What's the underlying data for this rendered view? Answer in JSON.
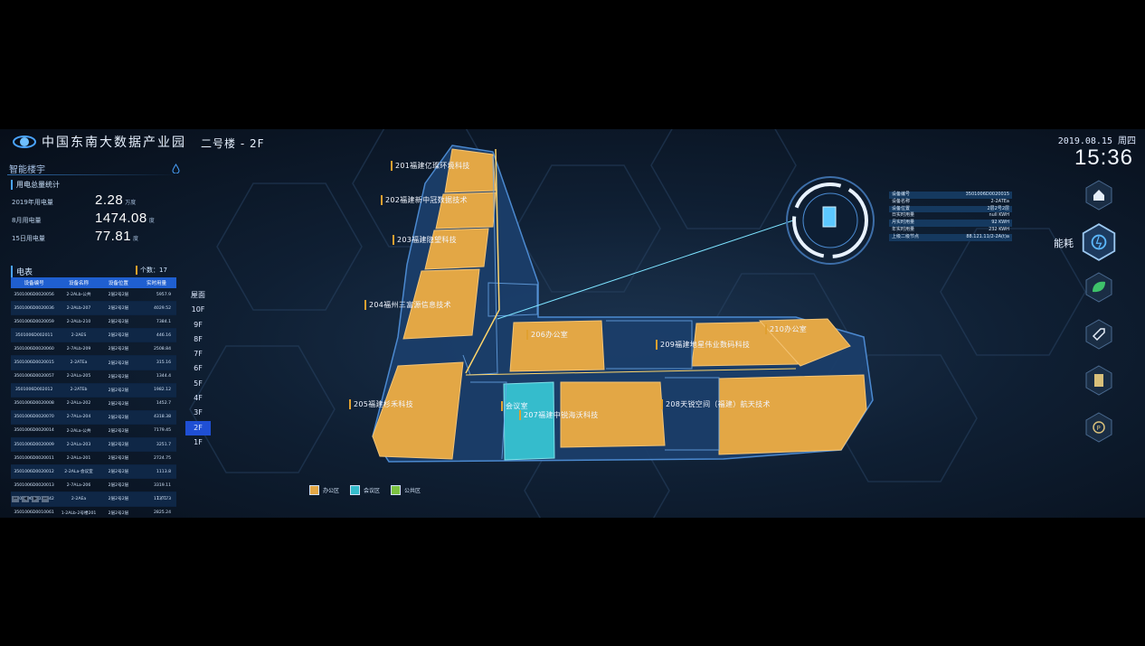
{
  "app_title": "中国东南大数据产业园",
  "building": "二号楼 - 2F",
  "datetime": {
    "date": "2019.08.15 周四",
    "time": "15:36"
  },
  "panel": {
    "title": "智能楼宇"
  },
  "stats": {
    "section_title": "用电总量统计",
    "rows": [
      {
        "label": "2019年用电量",
        "value": "2.28",
        "unit": "万度"
      },
      {
        "label": "8月用电量",
        "value": "1474.08",
        "unit": "度"
      },
      {
        "label": "15日用电量",
        "value": "77.81",
        "unit": "度"
      }
    ]
  },
  "meter": {
    "title": "电表",
    "count": "个数：17",
    "headers": [
      "设备编号",
      "设备名称",
      "设备位置",
      "实时用量"
    ],
    "rows": [
      [
        "3501006D0020056",
        "2-2ALb-公共",
        "2层2号2层",
        "5957.9"
      ],
      [
        "3501006D0020036",
        "2-2ALb-207",
        "2层2号2层",
        "4029.52"
      ],
      [
        "3501006D0020059",
        "2-2ALb-210",
        "2层2号2层",
        "7384.1"
      ],
      [
        "3501006D002011",
        "2-2AES",
        "2层2号2层",
        "446.16"
      ],
      [
        "3501006D0020060",
        "2-7ALb-209",
        "2层2号2层",
        "2508.84"
      ],
      [
        "3501006D0020015",
        "2-2ATEa",
        "2层2号2层",
        "315.16"
      ],
      [
        "3501006D0020057",
        "2-2ALa-205",
        "2层2号2层",
        "1344.4"
      ],
      [
        "3501006D002012",
        "2-2ATEb",
        "2层2号2层",
        "1982.12"
      ],
      [
        "3501006D0020008",
        "2-2ALa-202",
        "2层2号2层",
        "1452.7"
      ],
      [
        "3501006D0020070",
        "2-7ALa-204",
        "2层2号2层",
        "4318.38"
      ],
      [
        "3501006D0020014",
        "2-2ALa-公共",
        "2层2号2层",
        "7179.45"
      ],
      [
        "3501006D0020009",
        "2-2ALa-203",
        "2层2号2层",
        "3251.7"
      ],
      [
        "3501006D0020011",
        "2-2ALa-201",
        "2层2号2层",
        "2724.75"
      ],
      [
        "3501006D0020012",
        "2-2ALa-会议室",
        "2层2号2层",
        "1113.8"
      ],
      [
        "3501006D0020013",
        "2-7ALa-206",
        "2层2号2层",
        "3319.11"
      ],
      [
        "3501006D0020142",
        "2-2AEa",
        "2层2号2层",
        "1737.73"
      ],
      [
        "3501006D0010061",
        "1-2ALb-2号楼201",
        "2层2号2层",
        "2825.24"
      ]
    ],
    "page": "1 / 1"
  },
  "floors": {
    "items": [
      "屋面",
      "10F",
      "9F",
      "8F",
      "7F",
      "6F",
      "5F",
      "4F",
      "3F",
      "2F",
      "1F"
    ],
    "active": "2F"
  },
  "rooms": [
    {
      "name": "201福建亿璨环境科技"
    },
    {
      "name": "202福建新中冠数据技术"
    },
    {
      "name": "203福建隐望科技"
    },
    {
      "name": "204福州三富源信息技术"
    },
    {
      "name": "205福建杉禾科技"
    },
    {
      "name": "206办公室"
    },
    {
      "name": "207福建中锐海沃科技"
    },
    {
      "name": "208天锐空间（福建）航天技术"
    },
    {
      "name": "209福建地星伟业数码科技"
    },
    {
      "name": "210办公室"
    },
    {
      "name": "会议室"
    }
  ],
  "legend": [
    {
      "label": "办公区",
      "color": "#e3a745"
    },
    {
      "label": "会议区",
      "color": "#35bccc"
    },
    {
      "label": "公共区",
      "color": "#7cc241"
    }
  ],
  "device_info": [
    {
      "k": "设备编号",
      "v": "3501006D0020015"
    },
    {
      "k": "设备名称",
      "v": "2-2ATEa"
    },
    {
      "k": "设备位置",
      "v": "2层2号2层"
    },
    {
      "k": "日实时用量",
      "v": "null KWH"
    },
    {
      "k": "月实时用量",
      "v": "92 KWH"
    },
    {
      "k": "年实时用量",
      "v": "232 KWH"
    },
    {
      "k": "上级二级节点",
      "v": "88.121.11/2-2A(t)a"
    }
  ],
  "right_nav": {
    "label": "能耗",
    "icons": [
      "home-icon",
      "energy-icon",
      "leaf-icon",
      "tag-icon",
      "document-icon",
      "p-icon"
    ]
  },
  "colors": {
    "office": "#e3a745",
    "meeting": "#35bccc",
    "public": "#7cc241",
    "accent": "#1f5fd0"
  }
}
